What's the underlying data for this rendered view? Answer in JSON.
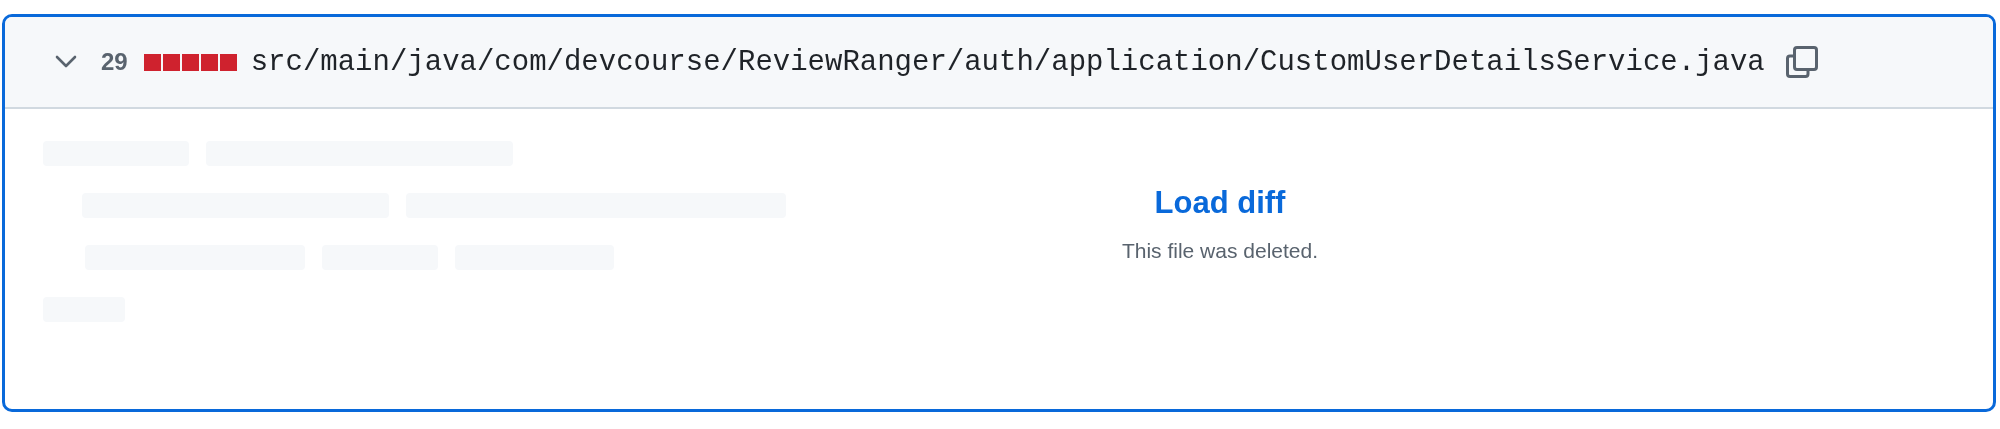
{
  "file_header": {
    "expanded": true,
    "changes": "29",
    "diffstat": [
      {
        "kind": "deleted"
      },
      {
        "kind": "deleted"
      },
      {
        "kind": "deleted"
      },
      {
        "kind": "deleted"
      },
      {
        "kind": "deleted"
      }
    ],
    "path": "src/main/java/com/devcourse/ReviewRanger/auth/application/CustomUserDetailsService.java"
  },
  "body": {
    "load_link": "Load diff",
    "message": "This file was deleted."
  }
}
